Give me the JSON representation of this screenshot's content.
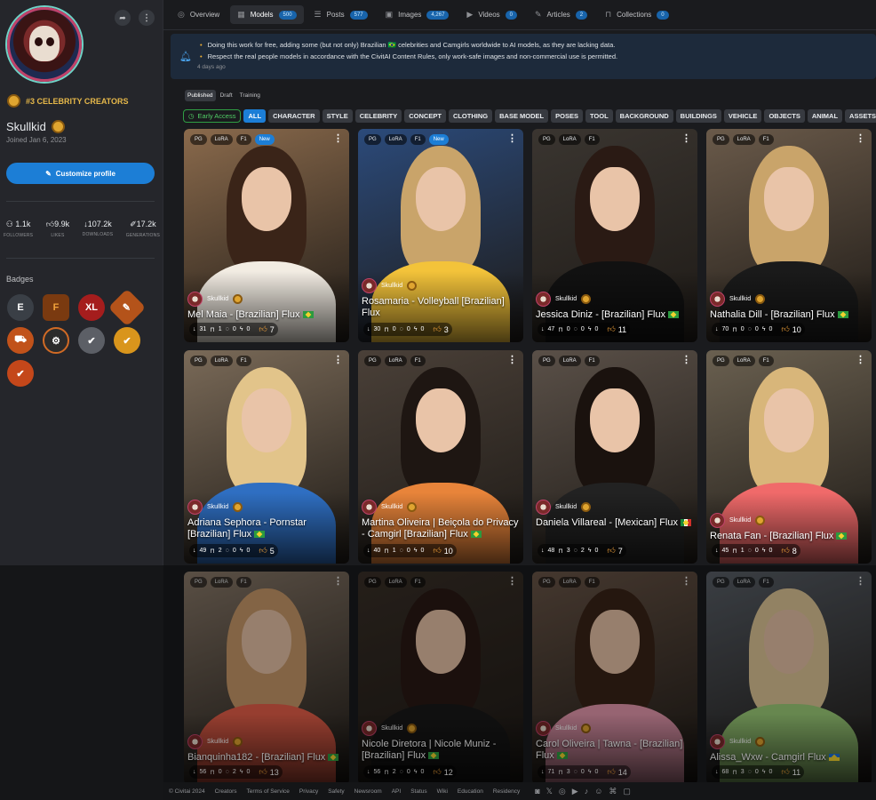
{
  "profile": {
    "rank_label": "#3 CELEBRITY CREATORS",
    "username": "Skullkid",
    "joined": "Joined Jan 6, 2023",
    "customize_label": "Customize profile",
    "stats": [
      {
        "value": "1.1k",
        "label": "FOLLOWERS",
        "icon": "user-icon"
      },
      {
        "value": "9.9k",
        "label": "LIKES",
        "icon": "thumbs-up-icon"
      },
      {
        "value": "107.2k",
        "label": "DOWNLOADS",
        "icon": "download-icon"
      },
      {
        "value": "17.2k",
        "label": "GENERATIONS",
        "icon": "brush-icon"
      }
    ],
    "badges_title": "Badges",
    "badge_xl_text": "XL"
  },
  "nav": {
    "tabs": [
      {
        "label": "Overview",
        "count": "",
        "icon": "overview-icon"
      },
      {
        "label": "Models",
        "count": "500",
        "icon": "models-icon"
      },
      {
        "label": "Posts",
        "count": "577",
        "icon": "posts-icon"
      },
      {
        "label": "Images",
        "count": "4,267",
        "icon": "images-icon"
      },
      {
        "label": "Videos",
        "count": "0",
        "icon": "video-icon"
      },
      {
        "label": "Articles",
        "count": "2",
        "icon": "pen-icon"
      },
      {
        "label": "Collections",
        "count": "0",
        "icon": "bookmark-icon"
      }
    ],
    "active": "Models"
  },
  "announcement": {
    "line1": "Doing this work for free, adding some (but not only) Brazilian 🇧🇷 celebrities and Camgirls worldwide to AI models, as they are lacking data.",
    "line2": "Respect the real people models in accordance with the CivitAI Content Rules, only work-safe images and non-commercial use is permitted.",
    "time": "4 days ago"
  },
  "subtabs": [
    "Published",
    "Draft",
    "Training"
  ],
  "filters": [
    "Early Access",
    "ALL",
    "CHARACTER",
    "STYLE",
    "CELEBRITY",
    "CONCEPT",
    "CLOTHING",
    "BASE MODEL",
    "POSES",
    "TOOL",
    "BACKGROUND",
    "BUILDINGS",
    "VEHICLE",
    "OBJECTS",
    "ANIMAL",
    "ASSETS"
  ],
  "cards": [
    {
      "title": "Mel Maia - [Brazilian] Flux",
      "flag": "br",
      "badge": "New",
      "user": "Skullkid",
      "downloads": "31",
      "saves": "1",
      "comments": "0",
      "tips": "0",
      "likes": "7",
      "pg": "PG",
      "type": "LoRA",
      "base": "F1"
    },
    {
      "title": "Rosamaria - Volleyball [Brazilian] Flux",
      "flag": "",
      "badge": "New",
      "user": "Skullkid",
      "downloads": "30",
      "saves": "0",
      "comments": "0",
      "tips": "0",
      "likes": "3",
      "pg": "PG",
      "type": "LoRA",
      "base": "F1"
    },
    {
      "title": "Jessica Diniz - [Brazilian] Flux",
      "flag": "br",
      "badge": "",
      "user": "Skullkid",
      "downloads": "47",
      "saves": "0",
      "comments": "0",
      "tips": "0",
      "likes": "11",
      "pg": "PG",
      "type": "LoRA",
      "base": "F1"
    },
    {
      "title": "Nathalia Dill - [Brazilian] Flux",
      "flag": "br",
      "badge": "",
      "user": "Skullkid",
      "downloads": "70",
      "saves": "0",
      "comments": "0",
      "tips": "0",
      "likes": "10",
      "pg": "PG",
      "type": "LoRA",
      "base": "F1"
    },
    {
      "title": "Adriana Sephora - Pornstar [Brazilian] Flux",
      "flag": "br",
      "badge": "",
      "user": "Skullkid",
      "downloads": "49",
      "saves": "2",
      "comments": "0",
      "tips": "0",
      "likes": "5",
      "pg": "PG",
      "type": "LoRA",
      "base": "F1"
    },
    {
      "title": "Martina Oliveira | Beiçola do Privacy - Camgirl [Brazilian] Flux",
      "flag": "br",
      "badge": "",
      "user": "Skullkid",
      "downloads": "40",
      "saves": "1",
      "comments": "0",
      "tips": "0",
      "likes": "10",
      "pg": "PG",
      "type": "LoRA",
      "base": "F1"
    },
    {
      "title": "Daniela Villareal - [Mexican] Flux",
      "flag": "mx",
      "badge": "",
      "user": "Skullkid",
      "downloads": "48",
      "saves": "3",
      "comments": "2",
      "tips": "0",
      "likes": "7",
      "pg": "PG",
      "type": "LoRA",
      "base": "F1"
    },
    {
      "title": "Renata Fan - [Brazilian] Flux",
      "flag": "br",
      "badge": "",
      "user": "Skullkid",
      "downloads": "45",
      "saves": "1",
      "comments": "0",
      "tips": "0",
      "likes": "8",
      "pg": "PG",
      "type": "LoRA",
      "base": "F1"
    },
    {
      "title": "Bianquinha182 - [Brazilian] Flux",
      "flag": "br",
      "badge": "",
      "user": "Skullkid",
      "downloads": "56",
      "saves": "0",
      "comments": "2",
      "tips": "0",
      "likes": "13",
      "pg": "PG",
      "type": "LoRA",
      "base": "F1"
    },
    {
      "title": "Nicole Diretora | Nicole Muniz - [Brazilian] Flux",
      "flag": "br",
      "badge": "",
      "user": "Skullkid",
      "downloads": "56",
      "saves": "2",
      "comments": "0",
      "tips": "0",
      "likes": "12",
      "pg": "PG",
      "type": "LoRA",
      "base": "F1"
    },
    {
      "title": "Carol Oliveira | Tawna - [Brazilian] Flux",
      "flag": "br",
      "badge": "",
      "user": "Skullkid",
      "downloads": "71",
      "saves": "3",
      "comments": "0",
      "tips": "0",
      "likes": "14",
      "pg": "PG",
      "type": "LoRA",
      "base": "F1"
    },
    {
      "title": "Alissa_Wxw - Camgirl Flux",
      "flag": "ua",
      "badge": "",
      "user": "Skullkid",
      "downloads": "68",
      "saves": "3",
      "comments": "0",
      "tips": "0",
      "likes": "11",
      "pg": "PG",
      "type": "LoRA",
      "base": "F1"
    }
  ],
  "footer": {
    "copyright": "© Civitai 2024",
    "links": [
      "Creators",
      "Terms of Service",
      "Privacy",
      "Safety",
      "Newsroom",
      "API",
      "Status",
      "Wiki",
      "Education",
      "Residency"
    ]
  },
  "colors": {
    "accent": "#1c7ed6",
    "gold": "#e6b84a",
    "brand_green": "#2f9e44"
  }
}
